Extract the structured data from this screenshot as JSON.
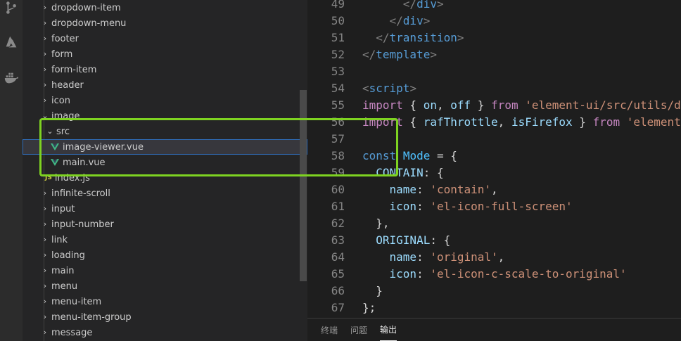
{
  "activity_bar": {
    "icons": [
      "source-control-icon",
      "azure-icon",
      "docker-icon"
    ]
  },
  "explorer": {
    "items": [
      {
        "label": "dropdown-item",
        "chevron": "›"
      },
      {
        "label": "dropdown-menu",
        "chevron": "›"
      },
      {
        "label": "footer",
        "chevron": "›"
      },
      {
        "label": "form",
        "chevron": "›"
      },
      {
        "label": "form-item",
        "chevron": "›"
      },
      {
        "label": "header",
        "chevron": "›"
      },
      {
        "label": "icon",
        "chevron": "›"
      },
      {
        "label": "image",
        "chevron": "⌄"
      },
      {
        "label": "src",
        "chevron": "⌄"
      },
      {
        "label": "image-viewer.vue"
      },
      {
        "label": "main.vue"
      },
      {
        "label": "index.js",
        "file_prefix": "JS"
      },
      {
        "label": "infinite-scroll",
        "chevron": "›"
      },
      {
        "label": "input",
        "chevron": "›"
      },
      {
        "label": "input-number",
        "chevron": "›"
      },
      {
        "label": "link",
        "chevron": "›"
      },
      {
        "label": "loading",
        "chevron": "›"
      },
      {
        "label": "main",
        "chevron": "›"
      },
      {
        "label": "menu",
        "chevron": "›"
      },
      {
        "label": "menu-item",
        "chevron": "›"
      },
      {
        "label": "menu-item-group",
        "chevron": "›"
      },
      {
        "label": "message",
        "chevron": "›"
      }
    ],
    "selected_item": "image-viewer.vue"
  },
  "editor": {
    "lines": [
      {
        "n": "49",
        "t": "      </div>"
      },
      {
        "n": "50",
        "t": "    </div>"
      },
      {
        "n": "51",
        "t": "  </transition>"
      },
      {
        "n": "52",
        "t": "</template>"
      },
      {
        "n": "53",
        "t": ""
      },
      {
        "n": "54",
        "t": "<script>"
      },
      {
        "n": "55",
        "t": "import { on, off } from 'element-ui/src/utils/d"
      },
      {
        "n": "56",
        "t": "import { rafThrottle, isFirefox } from 'element"
      },
      {
        "n": "57",
        "t": ""
      },
      {
        "n": "58",
        "t": "const Mode = {"
      },
      {
        "n": "59",
        "t": "  CONTAIN: {"
      },
      {
        "n": "60",
        "t": "    name: 'contain',"
      },
      {
        "n": "61",
        "t": "    icon: 'el-icon-full-screen'"
      },
      {
        "n": "62",
        "t": "  },"
      },
      {
        "n": "63",
        "t": "  ORIGINAL: {"
      },
      {
        "n": "64",
        "t": "    name: 'original',"
      },
      {
        "n": "65",
        "t": "    icon: 'el-icon-c-scale-to-original'"
      },
      {
        "n": "66",
        "t": "  }"
      },
      {
        "n": "67",
        "t": "};"
      }
    ]
  },
  "panel": {
    "tabs": [
      {
        "label": "终端",
        "active": false
      },
      {
        "label": "问题",
        "active": false
      },
      {
        "label": "输出",
        "active": true
      }
    ]
  },
  "colors": {
    "highlight_box": "#7ed321",
    "selection_border": "#2f6bb5",
    "vue_green": "#41b883"
  }
}
